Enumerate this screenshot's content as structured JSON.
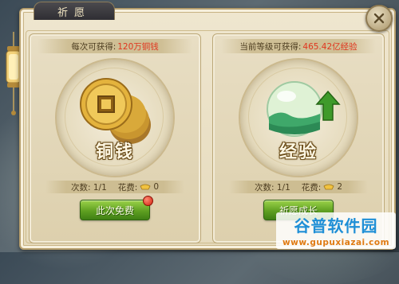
{
  "window": {
    "title": "祈愿"
  },
  "icons": {
    "close": "close-icon",
    "lantern": "lantern-icon",
    "coin": "copper-coin-icon",
    "exp": "exp-orb-icon",
    "ingot": "gold-ingot-icon",
    "notify": "red-dot-badge"
  },
  "cards": [
    {
      "gain_prefix": "每次可获得:",
      "gain_value": "120万铜钱",
      "label": "铜钱",
      "count_text": "次数: 1/1",
      "cost_label": "花费:",
      "cost_value": "0",
      "button_label": "此次免费",
      "has_badge": true
    },
    {
      "gain_prefix": "当前等级可获得:",
      "gain_value": "465.42亿经验",
      "label": "经验",
      "count_text": "次数: 1/1",
      "cost_label": "花费:",
      "cost_value": "2",
      "button_label": "祈愿成长",
      "has_badge": false
    }
  ],
  "watermark": {
    "title": "谷普软件园",
    "url": "www.gupuxiazai.com"
  },
  "colors": {
    "highlight": "#e0361f",
    "button_green": "#5fa021",
    "watermark_blue": "#1f8fd6",
    "watermark_orange": "#e07a12"
  }
}
